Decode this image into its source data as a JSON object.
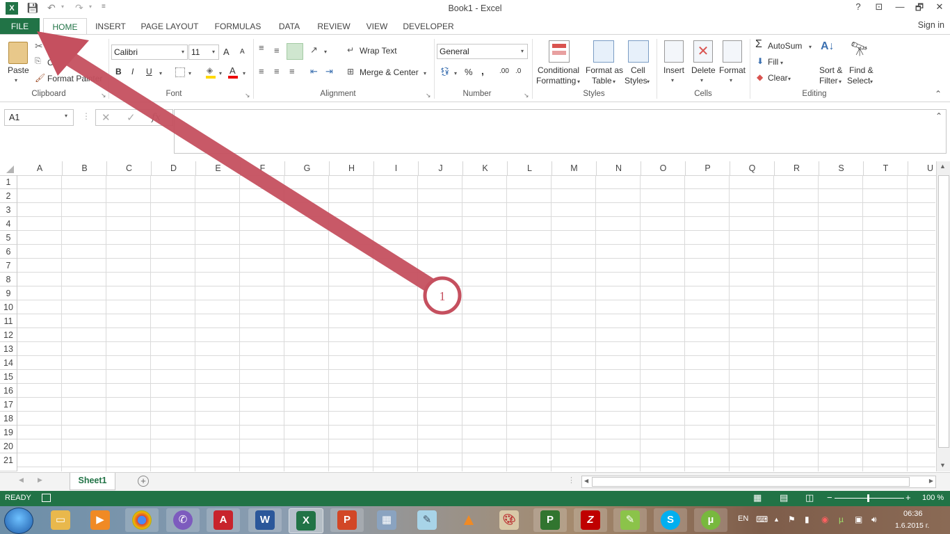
{
  "window": {
    "title": "Book1 - Excel",
    "help": "?",
    "minimize": "—",
    "restore": "🗗",
    "close": "✕",
    "ribbon_display": "⊡"
  },
  "tabs": [
    "FILE",
    "HOME",
    "INSERT",
    "PAGE LAYOUT",
    "FORMULAS",
    "DATA",
    "REVIEW",
    "VIEW",
    "DEVELOPER"
  ],
  "sign_in": "Sign in",
  "clipboard": {
    "paste": "Paste",
    "cut": "Cut",
    "copy": "Copy",
    "format_painter": "Format Painter",
    "label": "Clipboard"
  },
  "font": {
    "name": "Calibri",
    "size": "11",
    "bold": "B",
    "italic": "I",
    "underline": "U",
    "grow": "A",
    "shrink": "A",
    "label": "Font"
  },
  "alignment": {
    "wrap_text": "Wrap Text",
    "merge_center": "Merge & Center",
    "label": "Alignment"
  },
  "number": {
    "format": "General",
    "percent": "%",
    "comma": ",",
    "inc_decimal": ".00",
    "label": "Number"
  },
  "styles": {
    "conditional_1": "Conditional",
    "conditional_2": "Formatting",
    "format_table_1": "Format as",
    "format_table_2": "Table",
    "cell_styles_1": "Cell",
    "cell_styles_2": "Styles",
    "label": "Styles"
  },
  "cells": {
    "insert": "Insert",
    "delete": "Delete",
    "format": "Format",
    "label": "Cells"
  },
  "editing": {
    "autosum": "AutoSum",
    "fill": "Fill",
    "clear": "Clear",
    "sort_1": "Sort &",
    "sort_2": "Filter",
    "find_1": "Find &",
    "find_2": "Select",
    "label": "Editing"
  },
  "formula_bar": {
    "name_box": "A1",
    "cancel": "✕",
    "enter": "✓",
    "fx": "fx",
    "value": ""
  },
  "columns": [
    "A",
    "B",
    "C",
    "D",
    "E",
    "F",
    "G",
    "H",
    "I",
    "J",
    "K",
    "L",
    "M",
    "N",
    "O",
    "P",
    "Q",
    "R",
    "S",
    "T",
    "U"
  ],
  "rows": [
    "1",
    "2",
    "3",
    "4",
    "5",
    "6",
    "7",
    "8",
    "9",
    "10",
    "11",
    "12",
    "13",
    "14",
    "15",
    "16",
    "17",
    "18",
    "19",
    "20",
    "21"
  ],
  "sheets": {
    "active": "Sheet1",
    "add": "+"
  },
  "status": {
    "ready": "READY",
    "zoom": "100 %"
  },
  "annotation": {
    "number": "1",
    "color": "#c5505f"
  },
  "taskbar": {
    "apps": [
      "Start",
      "Windows Explorer",
      "Media Player",
      "Chrome",
      "Viber",
      "AutoCAD",
      "Word",
      "Excel",
      "PowerPoint",
      "Calculator",
      "Notepad",
      "VLC",
      "Paint",
      "Project",
      "FileZilla",
      "Notepad++",
      "Skype",
      "uTorrent"
    ],
    "lang": "EN",
    "time": "06:36",
    "date": "1.6.2015 г."
  },
  "colors": {
    "excel_green": "#217346",
    "annotation": "#c5505f"
  }
}
